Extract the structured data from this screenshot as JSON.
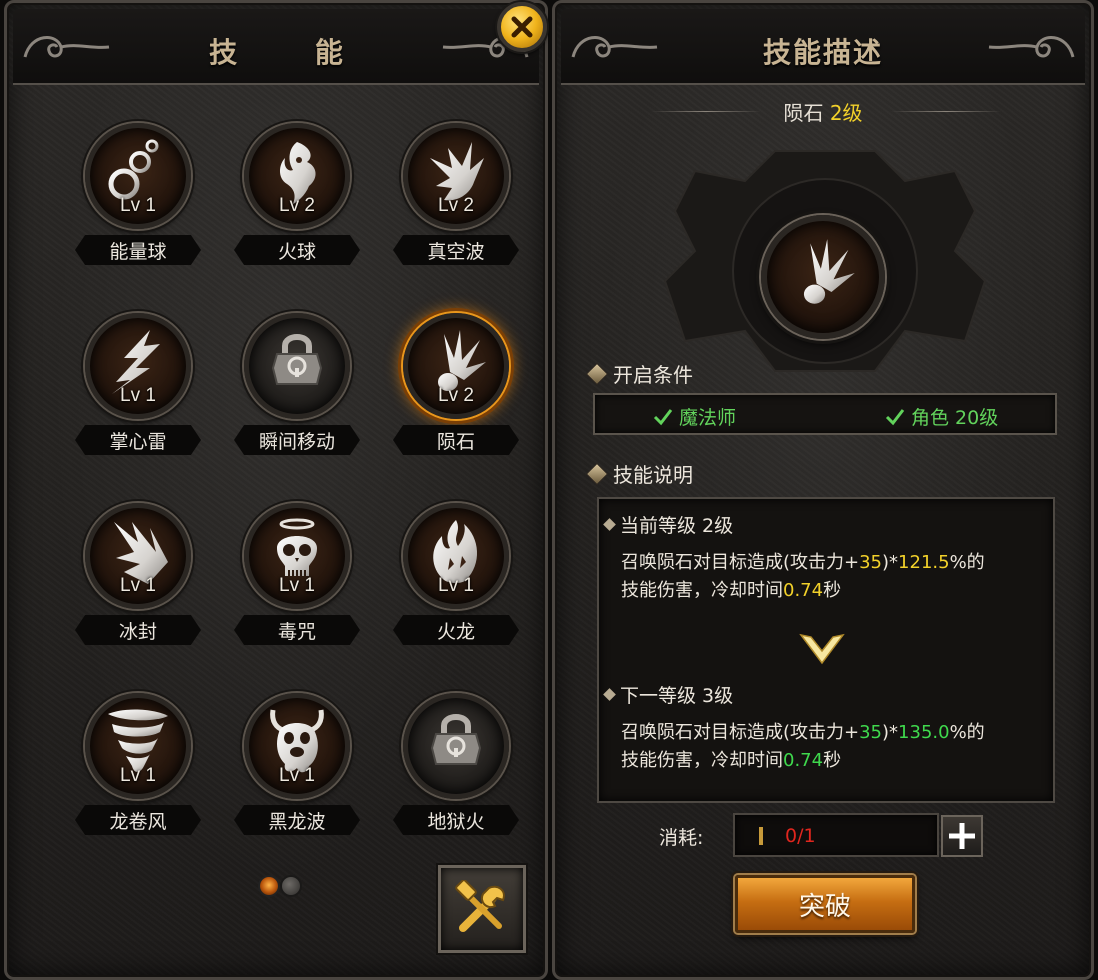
{
  "left_panel": {
    "title": "技 能",
    "skills": [
      {
        "name": "能量球",
        "level": "Lv 1",
        "icon": "energy-orbs-icon",
        "selected": false
      },
      {
        "name": "火球",
        "level": "Lv 2",
        "icon": "fire-spirit-icon",
        "selected": false
      },
      {
        "name": "真空波",
        "level": "Lv 2",
        "icon": "vacuum-wave-icon",
        "selected": false
      },
      {
        "name": "掌心雷",
        "level": "Lv 1",
        "icon": "lightning-icon",
        "selected": false
      },
      {
        "name": "瞬间移动",
        "level": "",
        "icon": "locked-padlock-icon",
        "selected": false
      },
      {
        "name": "陨石",
        "level": "Lv 2",
        "icon": "meteor-icon",
        "selected": true
      },
      {
        "name": "冰封",
        "level": "Lv 1",
        "icon": "ice-shards-icon",
        "selected": false
      },
      {
        "name": "毒咒",
        "level": "Lv 1",
        "icon": "skull-halo-icon",
        "selected": false
      },
      {
        "name": "火龙",
        "level": "Lv 1",
        "icon": "fire-dragon-icon",
        "selected": false
      },
      {
        "name": "龙卷风",
        "level": "Lv 1",
        "icon": "tornado-icon",
        "selected": false
      },
      {
        "name": "黑龙波",
        "level": "Lv 1",
        "icon": "demon-ghost-icon",
        "selected": false
      },
      {
        "name": "地狱火",
        "level": "",
        "icon": "locked-padlock-icon",
        "selected": false
      }
    ],
    "pages": {
      "current": 1,
      "total": 2
    }
  },
  "right_panel": {
    "title": "技能描述",
    "skill_name": "陨石",
    "skill_level": "2级",
    "requirements_heading": "开启条件",
    "requirements": [
      "魔法师",
      "角色 20级"
    ],
    "description_heading": "技能说明",
    "current": {
      "heading": "当前等级 2级",
      "line1_a": "召唤陨石对目标造成(攻击力+",
      "attack_bonus": "35",
      "line1_b": ")*",
      "percent": "121.5",
      "line1_c": "%的",
      "line2_a": "技能伤害，冷却时间",
      "cooldown": "0.74",
      "line2_b": "秒"
    },
    "next": {
      "heading": "下一等级 3级",
      "line1_a": "召唤陨石对目标造成(攻击力+",
      "attack_bonus": "35",
      "line1_b": ")*",
      "percent": "135.0",
      "line1_c": "%的",
      "line2_a": "技能伤害，冷却时间",
      "cooldown": "0.74",
      "line2_b": "秒"
    },
    "cost_label": "消耗:",
    "cost_value": "0/1",
    "breakthrough_label": "突破"
  },
  "colors": {
    "accent_gold": "#f2d12a",
    "requirement_green": "#62d35c",
    "value_green": "#3fd94d",
    "cost_red": "#e0261e",
    "button_orange": "#c66e12"
  }
}
